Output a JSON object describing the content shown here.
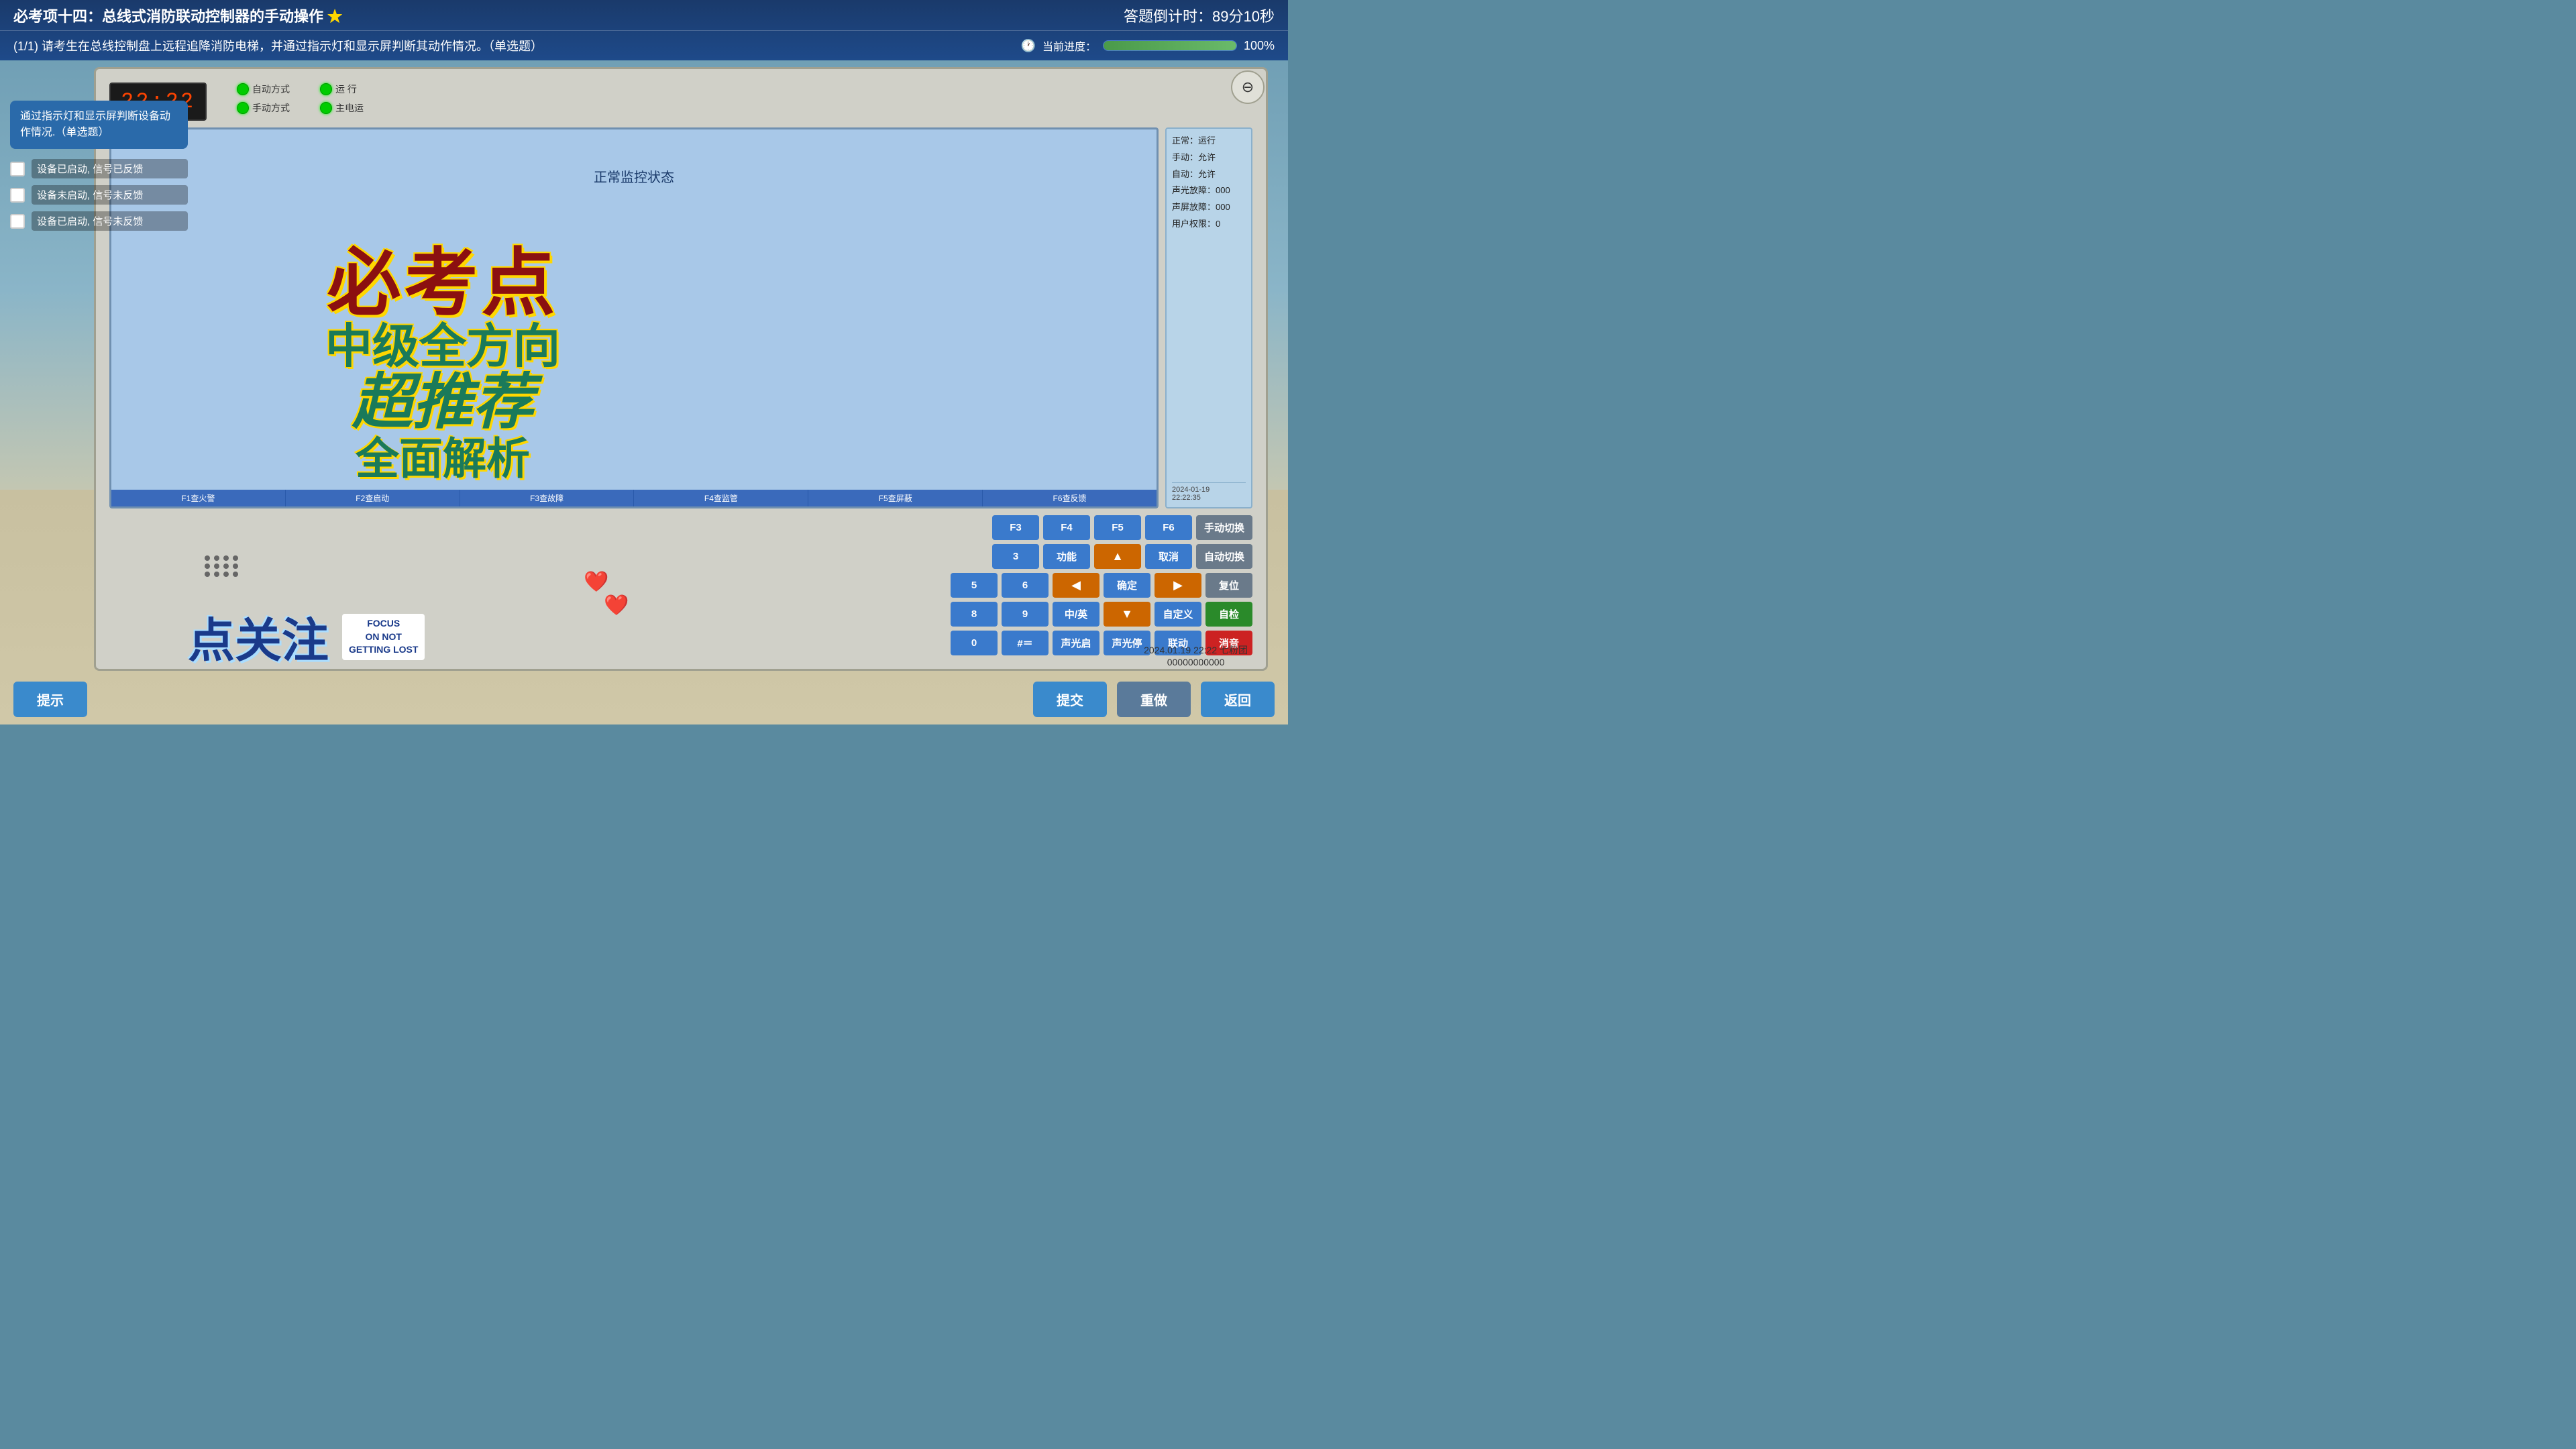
{
  "header": {
    "title": "必考项十四：总线式消防联动控制器的手动操作",
    "star": "★",
    "timer_label": "答题倒计时：89分10秒",
    "question": "(1/1) 请考生在总线控制盘上远程追降消防电梯，并通过指示灯和显示屏判断其动作情况。（单选题）",
    "progress_label": "当前进度：",
    "progress_pct": "100%",
    "progress_value": 100
  },
  "left_panel": {
    "question_text": "通过指示灯和显示屏判断设备动作情况.（单选题）",
    "options": [
      {
        "label": "设备已启动, 信号已反馈"
      },
      {
        "label": "设备未启动, 信号未反馈"
      },
      {
        "label": "设备已启动, 信号未反馈"
      }
    ]
  },
  "device_panel": {
    "clock_display": "22:22",
    "indicator_rows": [
      {
        "label": "自动方式",
        "color": "green"
      },
      {
        "label": "手动方式",
        "color": "green"
      }
    ],
    "status_indicators": [
      {
        "label": "运  行",
        "color": "green"
      },
      {
        "label": "主电运",
        "color": "green"
      }
    ],
    "lcd_status": "正常监控状态",
    "lcd_functions": [
      "F1查火警",
      "F2查启动",
      "F3查故障",
      "F4查监管",
      "F5查屏蔽",
      "F6查反馈"
    ],
    "right_status": {
      "line1": "正常：运行",
      "line2": "手动：允许",
      "line3": "自动：允许",
      "line4": "声光放障：000",
      "line5": "声屏放障：000",
      "line6": "用户权限：0",
      "date": "2024-01-19",
      "time": "22:22:35"
    },
    "buttons": {
      "row1": [
        "F3",
        "F4",
        "F5",
        "F6",
        "手动切换"
      ],
      "row2": [
        "3",
        "功能",
        "▲",
        "取消",
        "自动切换"
      ],
      "row3": [
        "5",
        "6",
        "◀",
        "确定",
        "▶",
        "复位"
      ],
      "row4": [
        "8",
        "9",
        "中/英",
        "▼",
        "自定义",
        "自检"
      ],
      "row5": [
        "0",
        "#＝",
        "声光启",
        "声光停",
        "联动",
        "消音"
      ]
    }
  },
  "promo": {
    "line1": "必考点",
    "line2": "中级全方向",
    "line3": "超推荐",
    "line4": "全面解析"
  },
  "bottom_promo": {
    "follow": "点关注",
    "focus_line1": "FOCUS",
    "focus_line2": "ON NOT",
    "focus_line3": "GETTING LOST"
  },
  "timestamp": {
    "text": "2024.01.19 22:22 七粉团",
    "id": "00000000000"
  },
  "bottom_buttons": {
    "hint": "提示",
    "submit": "提交",
    "redo": "重做",
    "return": "返回"
  },
  "zoom": {
    "icon": "⊖"
  }
}
